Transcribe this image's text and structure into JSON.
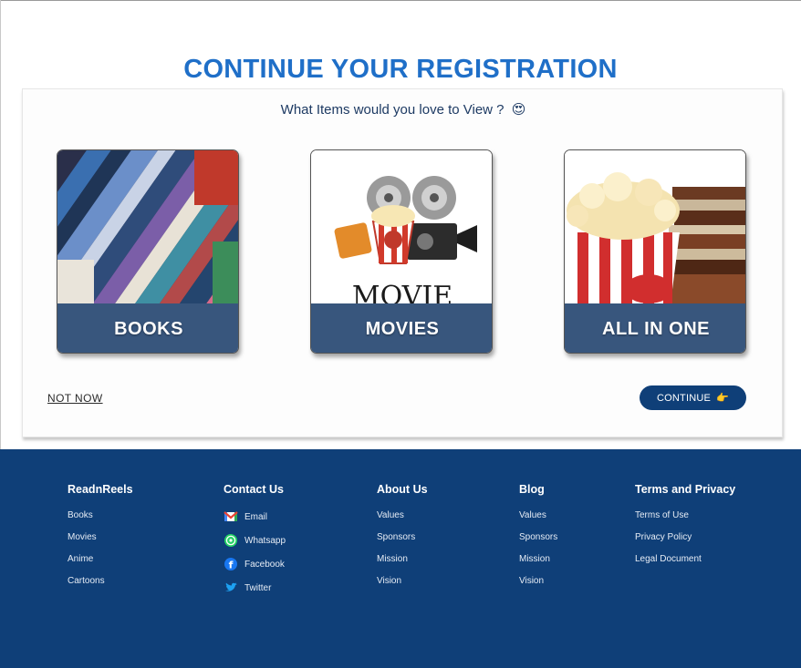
{
  "title": "CONTINUE YOUR REGISTRATION",
  "question": {
    "text": "What Items would you love to View ?",
    "emoji": "😍"
  },
  "options": [
    {
      "label": "BOOKS"
    },
    {
      "label": "MOVIES"
    },
    {
      "label": "ALL IN ONE"
    }
  ],
  "actions": {
    "not_now": "NOT NOW",
    "continue": "CONTINUE",
    "continue_emoji": "👉"
  },
  "footer": {
    "brand": {
      "title": "ReadnReels",
      "links": [
        "Books",
        "Movies",
        "Anime",
        "Cartoons"
      ]
    },
    "contact": {
      "title": "Contact Us",
      "links": [
        {
          "label": "Email",
          "icon": "gmail-icon"
        },
        {
          "label": "Whatsapp",
          "icon": "whatsapp-icon"
        },
        {
          "label": "Facebook",
          "icon": "facebook-icon"
        },
        {
          "label": "Twitter",
          "icon": "twitter-icon"
        }
      ]
    },
    "about": {
      "title": "About Us",
      "links": [
        "Values",
        "Sponsors",
        "Mission",
        "Vision"
      ]
    },
    "blog": {
      "title": "Blog",
      "links": [
        "Values",
        "Sponsors",
        "Mission",
        "Vision"
      ]
    },
    "terms": {
      "title": "Terms and Privacy",
      "links": [
        "Terms of Use",
        "Privacy Policy",
        "Legal Document"
      ]
    }
  },
  "colors": {
    "accent": "#1f6fc8",
    "navy": "#0f3f78",
    "label_overlay": "#173a68"
  }
}
